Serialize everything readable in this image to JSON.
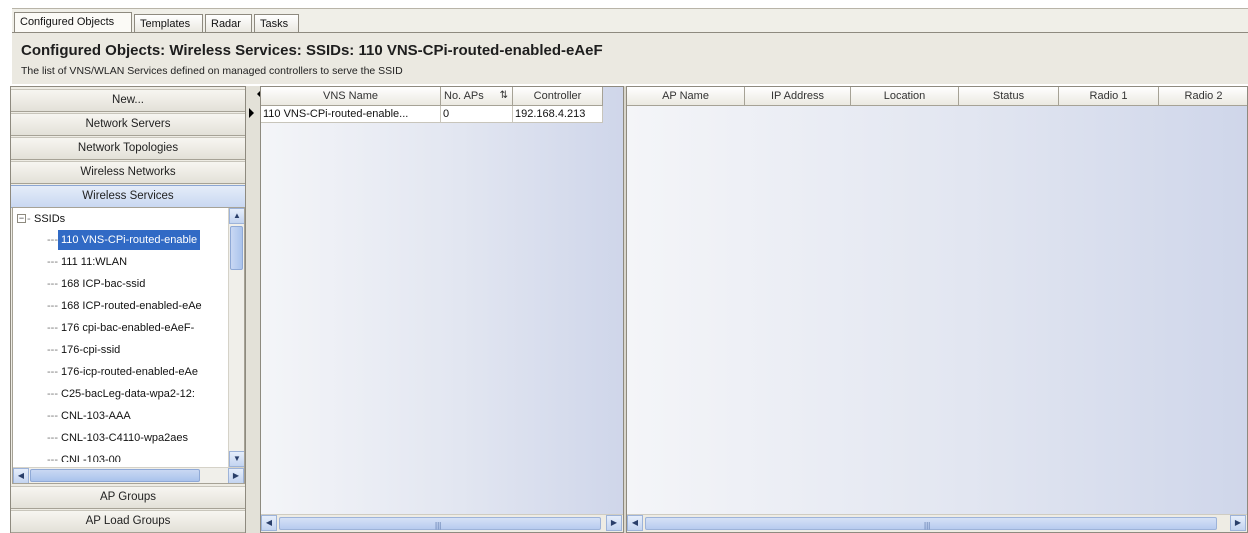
{
  "tabs": [
    "Configured Objects",
    "Templates",
    "Radar",
    "Tasks"
  ],
  "header": {
    "title": "Configured Objects: Wireless Services: SSIDs: 110 VNS-CPi-routed-enabled-eAeF",
    "subtitle": "The list of VNS/WLAN Services defined on managed controllers to serve the SSID"
  },
  "nav": {
    "buttons": [
      "New...",
      "Network Servers",
      "Network Topologies",
      "Wireless Networks",
      "Wireless Services"
    ],
    "bottom_buttons": [
      "AP Groups",
      "AP Load Groups"
    ],
    "active": "Wireless Services"
  },
  "tree": {
    "root": "SSIDs",
    "items": [
      "110 VNS-CPi-routed-enable",
      "111 11:WLAN",
      "168 ICP-bac-ssid",
      "168 ICP-routed-enabled-eAe",
      "176 cpi-bac-enabled-eAeF-",
      "176-cpi-ssid",
      "176-icp-routed-enabled-eAe",
      "C25-bacLeg-data-wpa2-12:",
      "CNL-103-AAA",
      "CNL-103-C4110-wpa2aes",
      "CNL-103-00"
    ],
    "selected_index": 0
  },
  "vns_table": {
    "columns": [
      "VNS Name",
      "No. APs",
      "Controller"
    ],
    "sort_indicator": "⇅",
    "rows": [
      [
        "110 VNS-CPi-routed-enable...",
        "0",
        "192.168.4.213"
      ]
    ]
  },
  "ap_table": {
    "columns": [
      "AP Name",
      "IP Address",
      "Location",
      "Status",
      "Radio 1",
      "Radio 2"
    ],
    "rows": []
  },
  "colors": {
    "selection": "#316ac5",
    "active_nav": "#c9d8f1",
    "panel": "#eeece4"
  }
}
